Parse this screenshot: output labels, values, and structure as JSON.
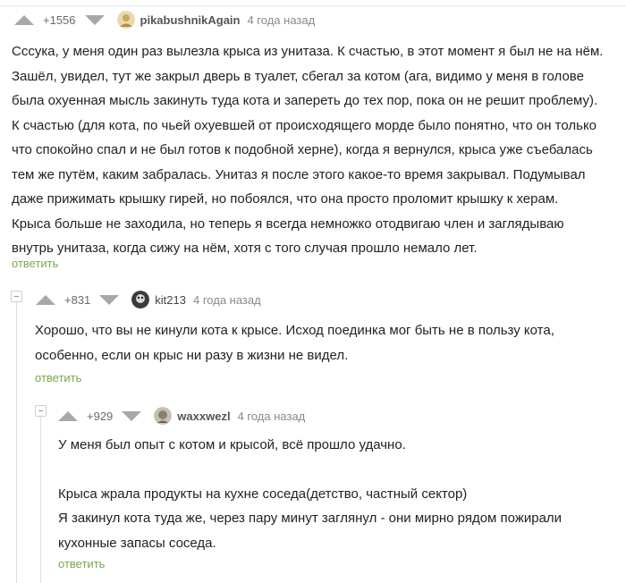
{
  "comments": [
    {
      "rating": "+1556",
      "nick": "pikabushnikAgain",
      "time": "4 года назад",
      "lines": [
        "Сссука, у меня один раз вылезла крыса из унитаза. К счастью, в этот момент я был не на нём.",
        "Зашёл, увидел, тут же закрыл дверь в туалет, сбегал за котом (ага, видимо у меня в голове",
        "была охуенная мысль закинуть туда кота и запереть до тех пор, пока он не решит проблему).",
        "К счастью (для кота, по чьей охуевшей от происходящего морде было понятно, что он только",
        "что спокойно спал и не был готов к подобной херне), когда я вернулся, крыса уже съебалась",
        "тем же путём, каким забралась. Унитаз я после этого какое-то время закрывал. Подумывал",
        "даже прижимать крышку гирей, но побоялся, что она просто проломит крышку к херам.",
        "Крыса больше не заходила, но теперь я всегда немножко отодвигаю член и заглядываю",
        "внутрь унитаза, когда сижу на нём, хотя с того случая прошло немало лет."
      ],
      "reply": "ответить"
    },
    {
      "rating": "+831",
      "nick": "kit213",
      "time": "4 года назад",
      "lines": [
        "Хорошо, что вы не кинули кота к крысе. Исход поединка мог быть не в пользу кота,",
        "особенно, если он крыс ни разу в жизни не видел."
      ],
      "reply": "ответить"
    },
    {
      "rating": "+929",
      "nick": "waxxwezl",
      "time": "4 года назад",
      "lines": [
        "У меня был опыт с котом и крысой, всё прошло удачно.",
        "",
        "Крыса жрала продукты на кухне соседа(детство, частный сектор)",
        "Я закинул кота туда же, через пару минут заглянул - они мирно рядом пожирали",
        "кухонные запасы соседа."
      ],
      "reply": "ответить"
    }
  ]
}
